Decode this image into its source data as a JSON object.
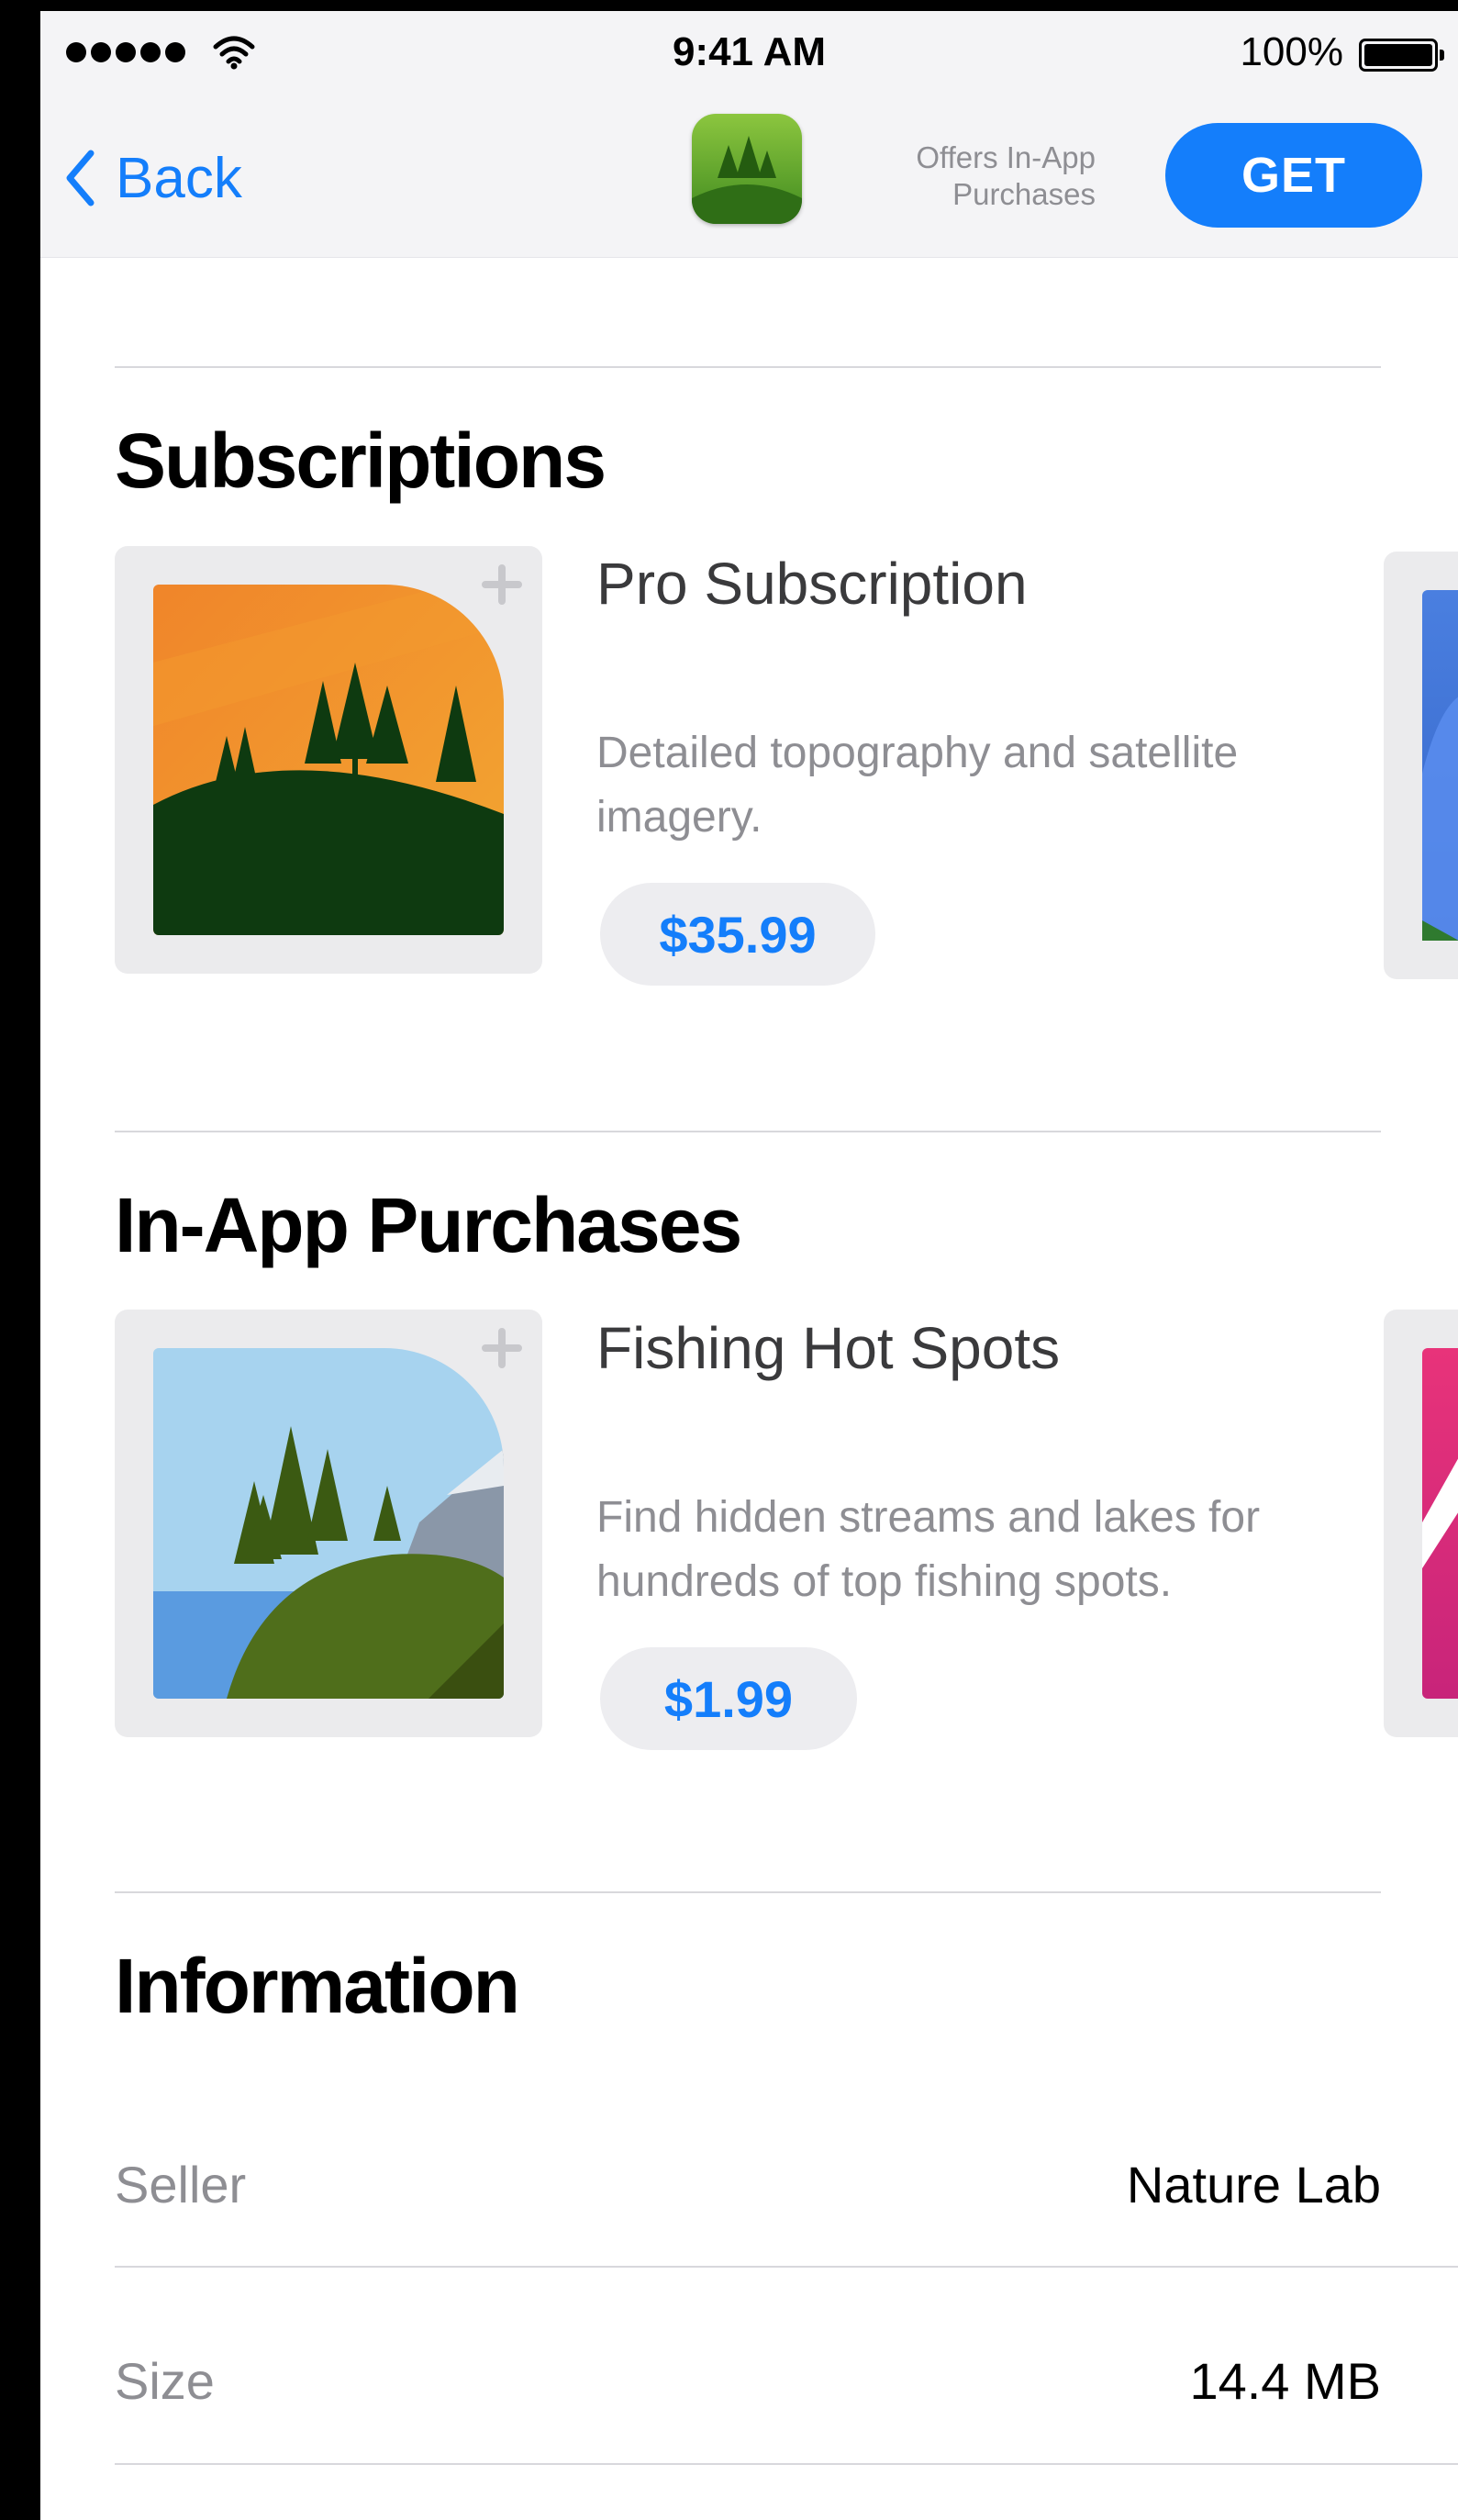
{
  "status_bar": {
    "time": "9:41 AM",
    "battery_percent": "100%",
    "signal_bars": 5,
    "icons": [
      "signal-dots-icon",
      "wifi-icon",
      "battery-icon"
    ]
  },
  "nav": {
    "back_label": "Back",
    "back_icon": "chevron-left-icon",
    "app_icon": "forest-app-icon",
    "in_app_note": "Offers In-App Purchases",
    "get_label": "GET"
  },
  "subscriptions": {
    "title": "Subscriptions",
    "item": {
      "name": "Pro Subscription",
      "description": "Detailed topography and satellite imagery.",
      "price": "$35.99",
      "image": "sunset-forest-hill-image"
    }
  },
  "in_app_purchases": {
    "title": "In-App Purchases",
    "item": {
      "name": "Fishing Hot Spots",
      "description": "Find hidden streams and lakes for hundreds of top fishing spots.",
      "price": "$1.99",
      "image": "lake-forest-image"
    }
  },
  "information": {
    "title": "Information",
    "rows": [
      {
        "label": "Seller",
        "value": "Nature Lab"
      },
      {
        "label": "Size",
        "value": "14.4 MB"
      }
    ]
  },
  "colors": {
    "accent": "#147efb",
    "secondary_text": "#8e8e93",
    "card_background": "#ebebed",
    "pill_background": "#ededf0"
  }
}
